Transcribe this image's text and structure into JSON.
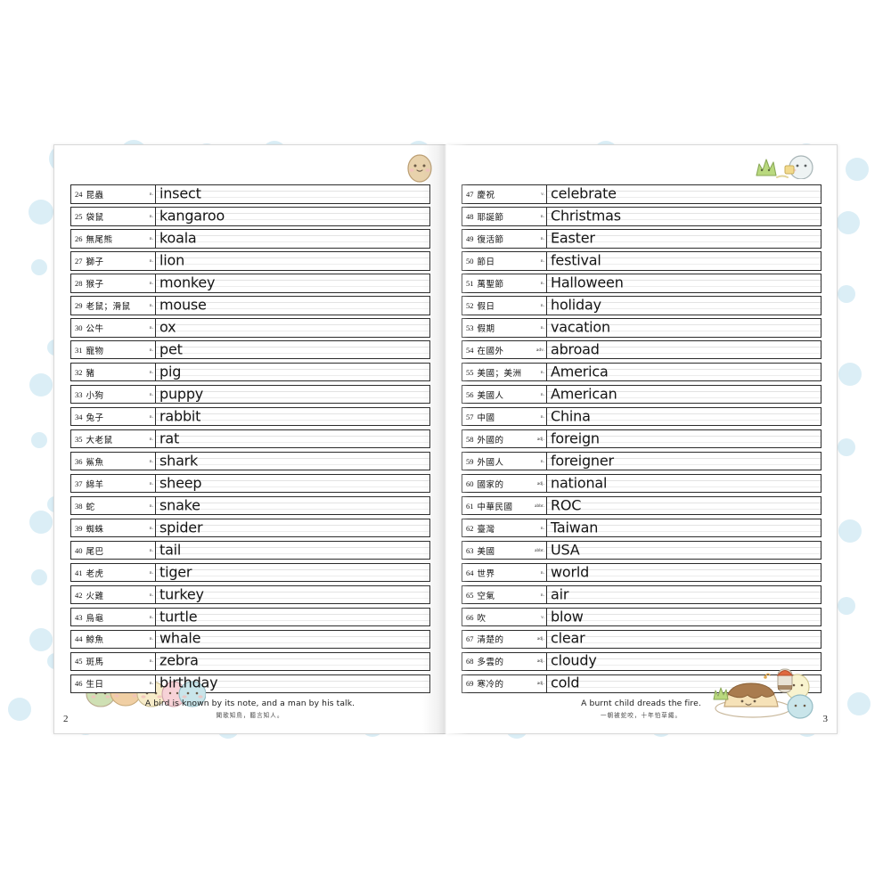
{
  "book": {
    "left_page": {
      "page_number": "2",
      "entries": [
        {
          "num": "24",
          "cn": "昆蟲",
          "pos": "n.",
          "en": "insect"
        },
        {
          "num": "25",
          "cn": "袋鼠",
          "pos": "n.",
          "en": "kangaroo"
        },
        {
          "num": "26",
          "cn": "無尾熊",
          "pos": "n.",
          "en": "koala"
        },
        {
          "num": "27",
          "cn": "獅子",
          "pos": "n.",
          "en": "lion"
        },
        {
          "num": "28",
          "cn": "猴子",
          "pos": "n.",
          "en": "monkey"
        },
        {
          "num": "29",
          "cn": "老鼠；滑鼠",
          "pos": "n.",
          "en": "mouse"
        },
        {
          "num": "30",
          "cn": "公牛",
          "pos": "n.",
          "en": "ox"
        },
        {
          "num": "31",
          "cn": "寵物",
          "pos": "n.",
          "en": "pet"
        },
        {
          "num": "32",
          "cn": "豬",
          "pos": "n.",
          "en": "pig"
        },
        {
          "num": "33",
          "cn": "小狗",
          "pos": "n.",
          "en": "puppy"
        },
        {
          "num": "34",
          "cn": "兔子",
          "pos": "n.",
          "en": "rabbit"
        },
        {
          "num": "35",
          "cn": "大老鼠",
          "pos": "n.",
          "en": "rat"
        },
        {
          "num": "36",
          "cn": "鯊魚",
          "pos": "n.",
          "en": "shark"
        },
        {
          "num": "37",
          "cn": "綿羊",
          "pos": "n.",
          "en": "sheep"
        },
        {
          "num": "38",
          "cn": "蛇",
          "pos": "n.",
          "en": "snake"
        },
        {
          "num": "39",
          "cn": "蜘蛛",
          "pos": "n.",
          "en": "spider"
        },
        {
          "num": "40",
          "cn": "尾巴",
          "pos": "n.",
          "en": "tail"
        },
        {
          "num": "41",
          "cn": "老虎",
          "pos": "n.",
          "en": "tiger"
        },
        {
          "num": "42",
          "cn": "火雞",
          "pos": "n.",
          "en": "turkey"
        },
        {
          "num": "43",
          "cn": "烏龜",
          "pos": "n.",
          "en": "turtle"
        },
        {
          "num": "44",
          "cn": "鯨魚",
          "pos": "n.",
          "en": "whale"
        },
        {
          "num": "45",
          "cn": "斑馬",
          "pos": "n.",
          "en": "zebra"
        },
        {
          "num": "46",
          "cn": "生日",
          "pos": "n.",
          "en": "birthday"
        }
      ],
      "proverb_en": "A bird is known by its note, and a man by his talk.",
      "proverb_cn": "聞歌知鳥，聽言知人。"
    },
    "right_page": {
      "page_number": "3",
      "entries": [
        {
          "num": "47",
          "cn": "慶祝",
          "pos": "v.",
          "en": "celebrate"
        },
        {
          "num": "48",
          "cn": "耶誕節",
          "pos": "n.",
          "en": "Christmas"
        },
        {
          "num": "49",
          "cn": "復活節",
          "pos": "n.",
          "en": "Easter"
        },
        {
          "num": "50",
          "cn": "節日",
          "pos": "n.",
          "en": "festival"
        },
        {
          "num": "51",
          "cn": "萬聖節",
          "pos": "n.",
          "en": "Halloween"
        },
        {
          "num": "52",
          "cn": "假日",
          "pos": "n.",
          "en": "holiday"
        },
        {
          "num": "53",
          "cn": "假期",
          "pos": "n.",
          "en": "vacation"
        },
        {
          "num": "54",
          "cn": "在國外",
          "pos": "adv.",
          "en": "abroad"
        },
        {
          "num": "55",
          "cn": "美國；美洲",
          "pos": "n.",
          "en": "America"
        },
        {
          "num": "56",
          "cn": "美國人",
          "pos": "n.",
          "en": "American"
        },
        {
          "num": "57",
          "cn": "中國",
          "pos": "n.",
          "en": "China"
        },
        {
          "num": "58",
          "cn": "外國的",
          "pos": "adj.",
          "en": "foreign"
        },
        {
          "num": "59",
          "cn": "外國人",
          "pos": "n.",
          "en": "foreigner"
        },
        {
          "num": "60",
          "cn": "國家的",
          "pos": "adj.",
          "en": "national"
        },
        {
          "num": "61",
          "cn": "中華民國",
          "pos": "abbr.",
          "en": "ROC"
        },
        {
          "num": "62",
          "cn": "臺灣",
          "pos": "n.",
          "en": "Taiwan"
        },
        {
          "num": "63",
          "cn": "美國",
          "pos": "abbr.",
          "en": "USA"
        },
        {
          "num": "64",
          "cn": "世界",
          "pos": "n.",
          "en": "world"
        },
        {
          "num": "65",
          "cn": "空氣",
          "pos": "n.",
          "en": "air"
        },
        {
          "num": "66",
          "cn": "吹",
          "pos": "v.",
          "en": "blow"
        },
        {
          "num": "67",
          "cn": "清楚的",
          "pos": "adj.",
          "en": "clear"
        },
        {
          "num": "68",
          "cn": "多雲的",
          "pos": "adj.",
          "en": "cloudy"
        },
        {
          "num": "69",
          "cn": "寒冷的",
          "pos": "adj.",
          "en": "cold"
        }
      ],
      "proverb_en": "A burnt child dreads the fire.",
      "proverb_cn": "一朝被蛇咬，十年怕草繩。"
    }
  },
  "decorations": {
    "top_left_page_char": "bear-cutlet-character-icon",
    "top_right_page_chars": "weed-and-penguin-characters-icon",
    "bottom_left_chars": "sumikko-group-characters-icon",
    "bottom_right_chars": "pudding-dessert-characters-icon"
  },
  "colors": {
    "dot": "#cfe8f3",
    "rule": "#2b2b2b",
    "paper": "#ffffff"
  }
}
